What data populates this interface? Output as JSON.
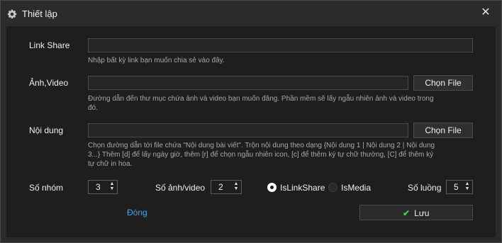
{
  "window": {
    "title": "Thiết lập",
    "close": "✕"
  },
  "link_share": {
    "label": "Link Share",
    "value": "",
    "hint": "Nhập bất kỳ link bạn muốn chia sẻ vào đây."
  },
  "media": {
    "label": "Ảnh,Video",
    "value": "",
    "button": "Chọn File",
    "hint_line1": "Đường dẫn đến thư mục chứa ảnh và video bạn muốn đăng. Phần mềm sẽ lấy ngẫu nhiên ảnh và video trong",
    "hint_line2": "đó."
  },
  "content": {
    "label": "Nội dung",
    "value": "",
    "button": "Chọn File",
    "hint_line1": "Chọn đường dẫn tới file chứa \"Nội dung bài viết\". Trộn nội dung theo dạng {Nội dung 1 | Nội dung 2 | Nội dung",
    "hint_line2": "3...} Thêm [d] để lấy ngày giờ, thêm [r] để chọn ngẫu nhiên icon, [c] để thêm ký tự chữ thường, [C] để thêm ký",
    "hint_line3": "tự chữ in hoa."
  },
  "options": {
    "groups_label": "Số nhóm",
    "groups_value": "3",
    "media_count_label": "Số ảnh/video",
    "media_count_value": "2",
    "radio_linkshare": "IsLinkShare",
    "radio_media": "IsMedia",
    "threads_label": "Số luồng",
    "threads_value": "5"
  },
  "actions": {
    "close": "Đóng",
    "save": "Lưu"
  }
}
